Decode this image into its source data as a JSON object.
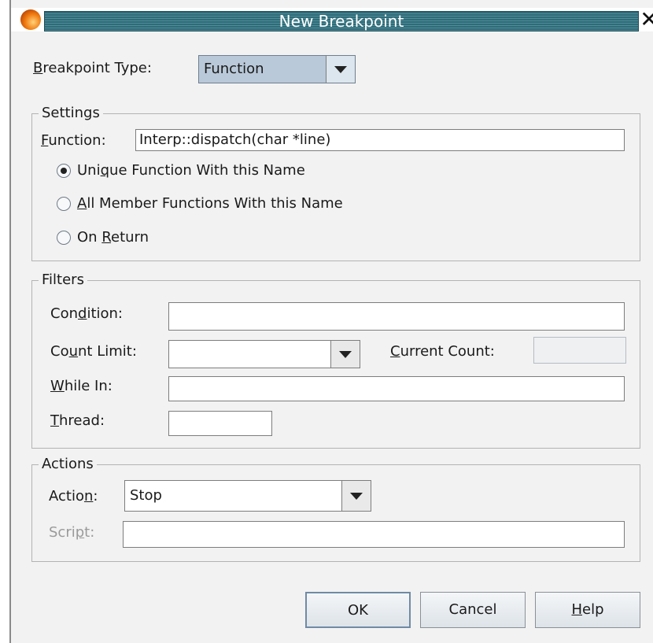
{
  "window": {
    "title": "New Breakpoint"
  },
  "breakpoint_type": {
    "label_pre": "",
    "label_mn": "B",
    "label_post": "reakpoint Type:",
    "value": "Function"
  },
  "settings": {
    "title": "Settings",
    "function": {
      "label_pre": "",
      "label_mn": "F",
      "label_post": "unction:",
      "value": "Interp::dispatch(char *line)"
    },
    "options": [
      {
        "pre": "Uni",
        "mn": "q",
        "post": "ue Function With this Name",
        "selected": true
      },
      {
        "pre": "",
        "mn": "A",
        "post": "ll Member Functions With this Name",
        "selected": false
      },
      {
        "pre": "On ",
        "mn": "R",
        "post": "eturn",
        "selected": false
      }
    ]
  },
  "filters": {
    "title": "Filters",
    "condition": {
      "pre": "Con",
      "mn": "d",
      "post": "ition:",
      "value": ""
    },
    "count_limit": {
      "pre": "Co",
      "mn": "u",
      "post": "nt Limit:",
      "value": ""
    },
    "current_count": {
      "pre": "",
      "mn": "C",
      "post": "urrent Count:",
      "value": ""
    },
    "while_in": {
      "pre": "",
      "mn": "W",
      "post": "hile In:",
      "value": ""
    },
    "thread": {
      "pre": "",
      "mn": "T",
      "post": "hread:",
      "value": ""
    }
  },
  "actions": {
    "title": "Actions",
    "action": {
      "pre": "Actio",
      "mn": "n",
      "post": ":",
      "value": "Stop"
    },
    "script": {
      "pre": "Scri",
      "mn": "p",
      "post": "t:",
      "value": ""
    }
  },
  "buttons": {
    "ok": "OK",
    "cancel": "Cancel",
    "help_pre": "",
    "help_mn": "H",
    "help_post": "elp"
  },
  "colors": {
    "title_bar": "#2f6b78",
    "selected_combo": "#b9c9d9",
    "dialog_bg": "#f2f2f2"
  },
  "icons": {
    "app": "app-logo-icon",
    "close": "close-icon",
    "dropdown": "chevron-down-icon"
  }
}
